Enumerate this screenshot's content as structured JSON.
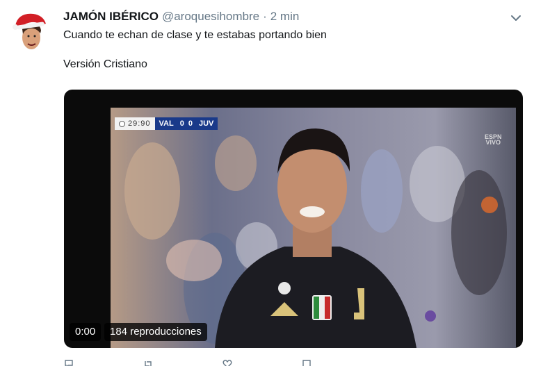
{
  "tweet": {
    "display_name": "JAMÓN IBÉRICO",
    "handle": "@aroquesihombre",
    "separator": "·",
    "time": "2 min",
    "text_line_1": "Cuando te echan de clase y te estabas portando bien",
    "text_line_2": "Versión Cristiano",
    "avatar": "avatar-santa-hat"
  },
  "media": {
    "scorebug": {
      "clock": "29:90",
      "home_team": "VAL",
      "home_score": "0",
      "away_score": "0",
      "away_team": "JUV"
    },
    "broadcaster_logo_line1": "ESPN",
    "broadcaster_logo_line2": "VIVO",
    "playback_time": "0:00",
    "views": "184 reproducciones"
  },
  "actions": {
    "icons": [
      "reply-icon",
      "retweet-icon",
      "like-icon",
      "share-icon"
    ]
  },
  "colors": {
    "text": "#14171a",
    "secondary": "#657786",
    "media_bg": "#0b0b0b"
  }
}
